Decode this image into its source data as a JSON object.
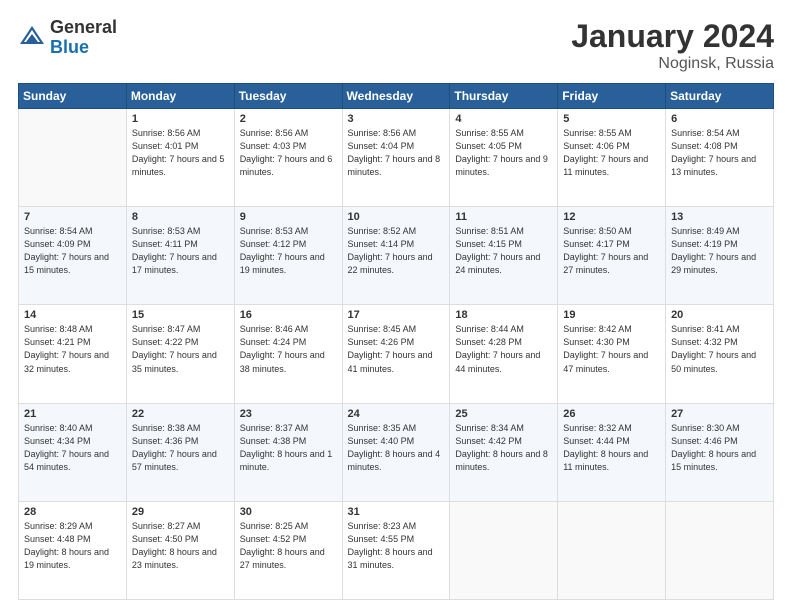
{
  "header": {
    "logo_line1": "General",
    "logo_line2": "Blue",
    "title": "January 2024",
    "subtitle": "Noginsk, Russia"
  },
  "days_of_week": [
    "Sunday",
    "Monday",
    "Tuesday",
    "Wednesday",
    "Thursday",
    "Friday",
    "Saturday"
  ],
  "weeks": [
    [
      {
        "day": "",
        "empty": true
      },
      {
        "day": "1",
        "sunrise": "8:56 AM",
        "sunset": "4:01 PM",
        "daylight": "7 hours and 5 minutes."
      },
      {
        "day": "2",
        "sunrise": "8:56 AM",
        "sunset": "4:03 PM",
        "daylight": "7 hours and 6 minutes."
      },
      {
        "day": "3",
        "sunrise": "8:56 AM",
        "sunset": "4:04 PM",
        "daylight": "7 hours and 8 minutes."
      },
      {
        "day": "4",
        "sunrise": "8:55 AM",
        "sunset": "4:05 PM",
        "daylight": "7 hours and 9 minutes."
      },
      {
        "day": "5",
        "sunrise": "8:55 AM",
        "sunset": "4:06 PM",
        "daylight": "7 hours and 11 minutes."
      },
      {
        "day": "6",
        "sunrise": "8:54 AM",
        "sunset": "4:08 PM",
        "daylight": "7 hours and 13 minutes."
      }
    ],
    [
      {
        "day": "7",
        "sunrise": "8:54 AM",
        "sunset": "4:09 PM",
        "daylight": "7 hours and 15 minutes."
      },
      {
        "day": "8",
        "sunrise": "8:53 AM",
        "sunset": "4:11 PM",
        "daylight": "7 hours and 17 minutes."
      },
      {
        "day": "9",
        "sunrise": "8:53 AM",
        "sunset": "4:12 PM",
        "daylight": "7 hours and 19 minutes."
      },
      {
        "day": "10",
        "sunrise": "8:52 AM",
        "sunset": "4:14 PM",
        "daylight": "7 hours and 22 minutes."
      },
      {
        "day": "11",
        "sunrise": "8:51 AM",
        "sunset": "4:15 PM",
        "daylight": "7 hours and 24 minutes."
      },
      {
        "day": "12",
        "sunrise": "8:50 AM",
        "sunset": "4:17 PM",
        "daylight": "7 hours and 27 minutes."
      },
      {
        "day": "13",
        "sunrise": "8:49 AM",
        "sunset": "4:19 PM",
        "daylight": "7 hours and 29 minutes."
      }
    ],
    [
      {
        "day": "14",
        "sunrise": "8:48 AM",
        "sunset": "4:21 PM",
        "daylight": "7 hours and 32 minutes."
      },
      {
        "day": "15",
        "sunrise": "8:47 AM",
        "sunset": "4:22 PM",
        "daylight": "7 hours and 35 minutes."
      },
      {
        "day": "16",
        "sunrise": "8:46 AM",
        "sunset": "4:24 PM",
        "daylight": "7 hours and 38 minutes."
      },
      {
        "day": "17",
        "sunrise": "8:45 AM",
        "sunset": "4:26 PM",
        "daylight": "7 hours and 41 minutes."
      },
      {
        "day": "18",
        "sunrise": "8:44 AM",
        "sunset": "4:28 PM",
        "daylight": "7 hours and 44 minutes."
      },
      {
        "day": "19",
        "sunrise": "8:42 AM",
        "sunset": "4:30 PM",
        "daylight": "7 hours and 47 minutes."
      },
      {
        "day": "20",
        "sunrise": "8:41 AM",
        "sunset": "4:32 PM",
        "daylight": "7 hours and 50 minutes."
      }
    ],
    [
      {
        "day": "21",
        "sunrise": "8:40 AM",
        "sunset": "4:34 PM",
        "daylight": "7 hours and 54 minutes."
      },
      {
        "day": "22",
        "sunrise": "8:38 AM",
        "sunset": "4:36 PM",
        "daylight": "7 hours and 57 minutes."
      },
      {
        "day": "23",
        "sunrise": "8:37 AM",
        "sunset": "4:38 PM",
        "daylight": "8 hours and 1 minute."
      },
      {
        "day": "24",
        "sunrise": "8:35 AM",
        "sunset": "4:40 PM",
        "daylight": "8 hours and 4 minutes."
      },
      {
        "day": "25",
        "sunrise": "8:34 AM",
        "sunset": "4:42 PM",
        "daylight": "8 hours and 8 minutes."
      },
      {
        "day": "26",
        "sunrise": "8:32 AM",
        "sunset": "4:44 PM",
        "daylight": "8 hours and 11 minutes."
      },
      {
        "day": "27",
        "sunrise": "8:30 AM",
        "sunset": "4:46 PM",
        "daylight": "8 hours and 15 minutes."
      }
    ],
    [
      {
        "day": "28",
        "sunrise": "8:29 AM",
        "sunset": "4:48 PM",
        "daylight": "8 hours and 19 minutes."
      },
      {
        "day": "29",
        "sunrise": "8:27 AM",
        "sunset": "4:50 PM",
        "daylight": "8 hours and 23 minutes."
      },
      {
        "day": "30",
        "sunrise": "8:25 AM",
        "sunset": "4:52 PM",
        "daylight": "8 hours and 27 minutes."
      },
      {
        "day": "31",
        "sunrise": "8:23 AM",
        "sunset": "4:55 PM",
        "daylight": "8 hours and 31 minutes."
      },
      {
        "day": "",
        "empty": true
      },
      {
        "day": "",
        "empty": true
      },
      {
        "day": "",
        "empty": true
      }
    ]
  ],
  "labels": {
    "sunrise": "Sunrise:",
    "sunset": "Sunset:",
    "daylight": "Daylight:"
  }
}
